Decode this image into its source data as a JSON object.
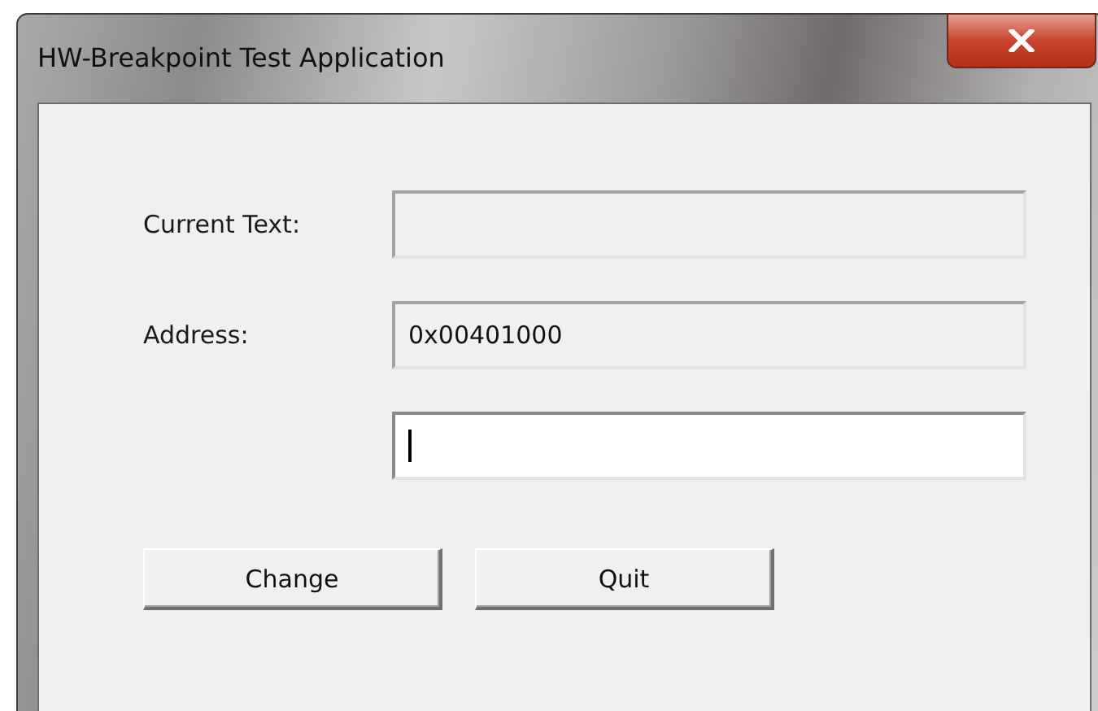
{
  "window": {
    "title": "HW-Breakpoint Test Application"
  },
  "fields": [
    {
      "label": "Current Text:",
      "disabled": true,
      "focused": false
    },
    {
      "label": "Address:",
      "value": "0x00401000",
      "disabled": true,
      "focused": false
    },
    {
      "disabled": false,
      "focused": true
    }
  ],
  "buttons": [
    "Change",
    "Quit"
  ]
}
